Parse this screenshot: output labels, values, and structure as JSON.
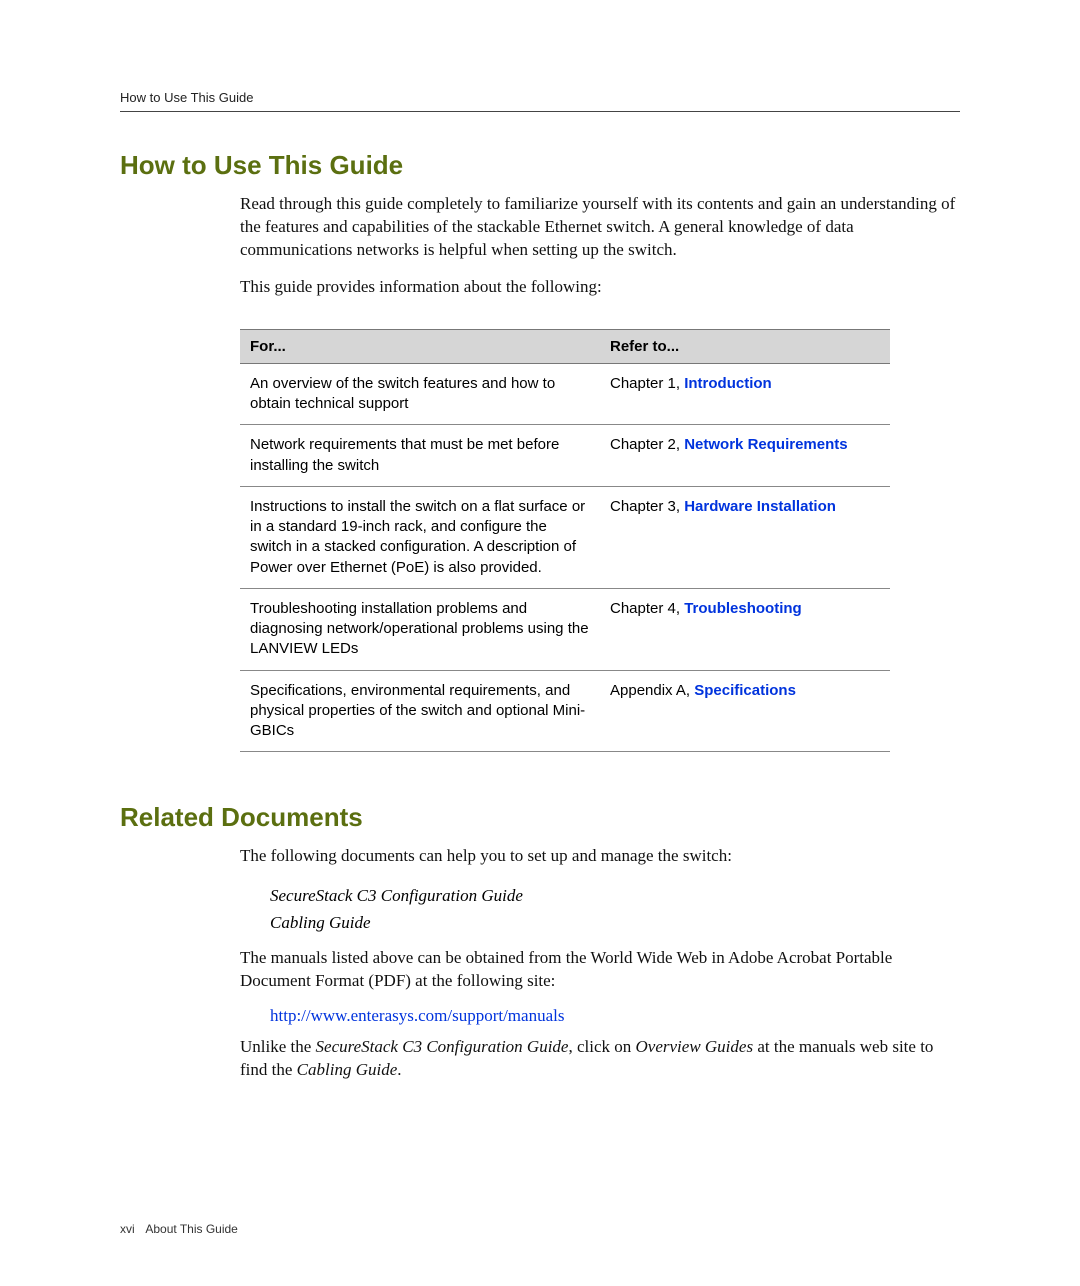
{
  "header": {
    "running": "How to Use This Guide"
  },
  "sections": {
    "how_to_use": {
      "title": "How to Use This Guide",
      "p1": "Read through this guide completely to familiarize yourself with its contents and gain an understanding of the features and capabilities of the stackable Ethernet switch. A general knowledge of data communications networks is helpful when setting up the switch.",
      "p2": "This guide provides information about the following:"
    },
    "related": {
      "title": "Related Documents",
      "p1": "The following documents can help you to set up and manage the switch:",
      "docs": {
        "d1": "SecureStack C3 Configuration Guide",
        "d2": "Cabling Guide"
      },
      "p2": "The manuals listed above can be obtained from the World Wide Web in Adobe Acrobat Portable Document Format (PDF) at the following site:",
      "url": "http://www.enterasys.com/support/manuals",
      "p3_a": "Unlike the ",
      "p3_b": "SecureStack C3 Configuration Guide",
      "p3_c": ", click on ",
      "p3_d": "Overview Guides",
      "p3_e": " at the manuals web site to find the ",
      "p3_f": "Cabling Guide",
      "p3_g": "."
    }
  },
  "table": {
    "head": {
      "for": "For...",
      "refer": "Refer to..."
    },
    "rows": [
      {
        "for": "An overview of the switch features and how to obtain technical support",
        "prefix": "Chapter 1, ",
        "link": "Introduction"
      },
      {
        "for": "Network requirements that must be met before installing the switch",
        "prefix": "Chapter 2, ",
        "link": "Network Requirements"
      },
      {
        "for": "Instructions to install the switch on a flat surface or in a standard 19-inch rack, and configure the switch in a stacked configuration. A description of Power over Ethernet (PoE) is also provided.",
        "prefix": "Chapter 3, ",
        "link": "Hardware Installation"
      },
      {
        "for": "Troubleshooting installation problems and diagnosing network/operational problems using the LANVIEW LEDs",
        "prefix": "Chapter 4, ",
        "link": "Troubleshooting"
      },
      {
        "for": "Specifications, environmental requirements, and physical properties of the switch and optional Mini-GBICs",
        "prefix": "Appendix A, ",
        "link": "Specifications"
      }
    ]
  },
  "footer": {
    "pagenum": "xvi",
    "section": "About This Guide"
  }
}
